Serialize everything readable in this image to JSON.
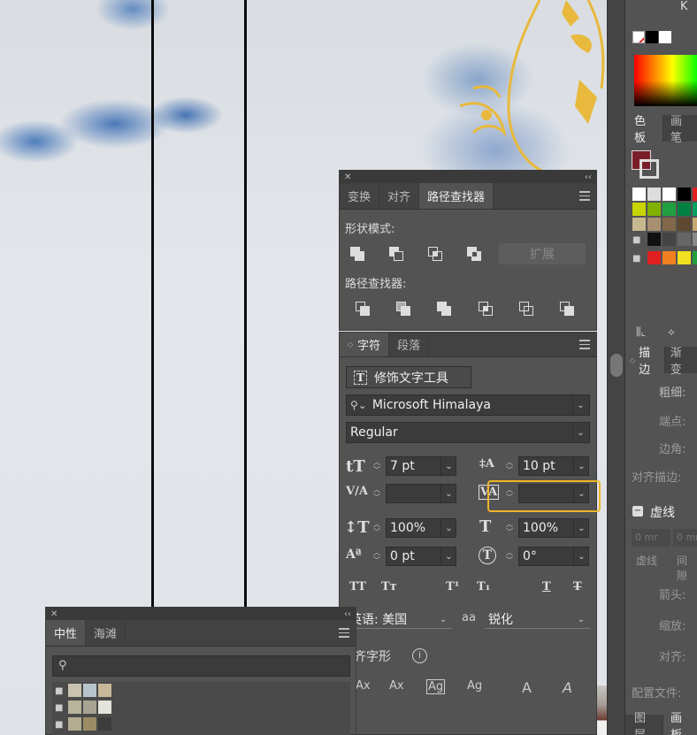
{
  "pathfinder_panel": {
    "tabs": [
      "变换",
      "对齐",
      "路径查找器"
    ],
    "active_tab": "路径查找器",
    "shape_modes_label": "形状模式:",
    "expand_button": "扩展",
    "pathfinders_label": "路径查找器:"
  },
  "character_panel": {
    "tabs": [
      "字符",
      "段落"
    ],
    "active_tab": "字符",
    "touch_type_button": "修饰文字工具",
    "font_family": "Microsoft Himalaya",
    "font_style": "Regular",
    "font_size": "7 pt",
    "leading": "10 pt",
    "kerning": "",
    "tracking": "",
    "vertical_scale": "100%",
    "horizontal_scale": "100%",
    "baseline_shift": "0 pt",
    "rotation": "0°",
    "style_buttons": [
      "TT",
      "Tт",
      "T¹",
      "T₁",
      "T",
      "T"
    ],
    "language": "英语: 美国",
    "antialias_icon": "aa",
    "antialias": "锐化",
    "snap_label": "齐字形"
  },
  "swatch_library_panel": {
    "tabs": [
      "中性",
      "海滩"
    ],
    "active_tab": "中性"
  },
  "right_dock": {
    "k_label": "K",
    "color_tabs": [
      "色板",
      "画笔"
    ],
    "stroke_tabs": [
      "描边",
      "渐变"
    ],
    "stroke_labels": {
      "weight": "粗细:",
      "cap": "端点:",
      "corner": "边角:",
      "align": "对齐描边:"
    },
    "dashed_label": "虚线",
    "dash_placeholder": "0 mr",
    "dash_labels": [
      "虚线",
      "间隙"
    ],
    "arrow_labels": {
      "arrow": "箭头:",
      "scale": "缩放:",
      "align": "对齐:"
    },
    "profile_label": "配置文件:",
    "bottom_tabs": [
      "图层",
      "画板"
    ]
  },
  "colors": {
    "accent_highlight": "#f0b429",
    "fill_swatch": "#7a1f2a",
    "ornament": "#e8b93c"
  }
}
